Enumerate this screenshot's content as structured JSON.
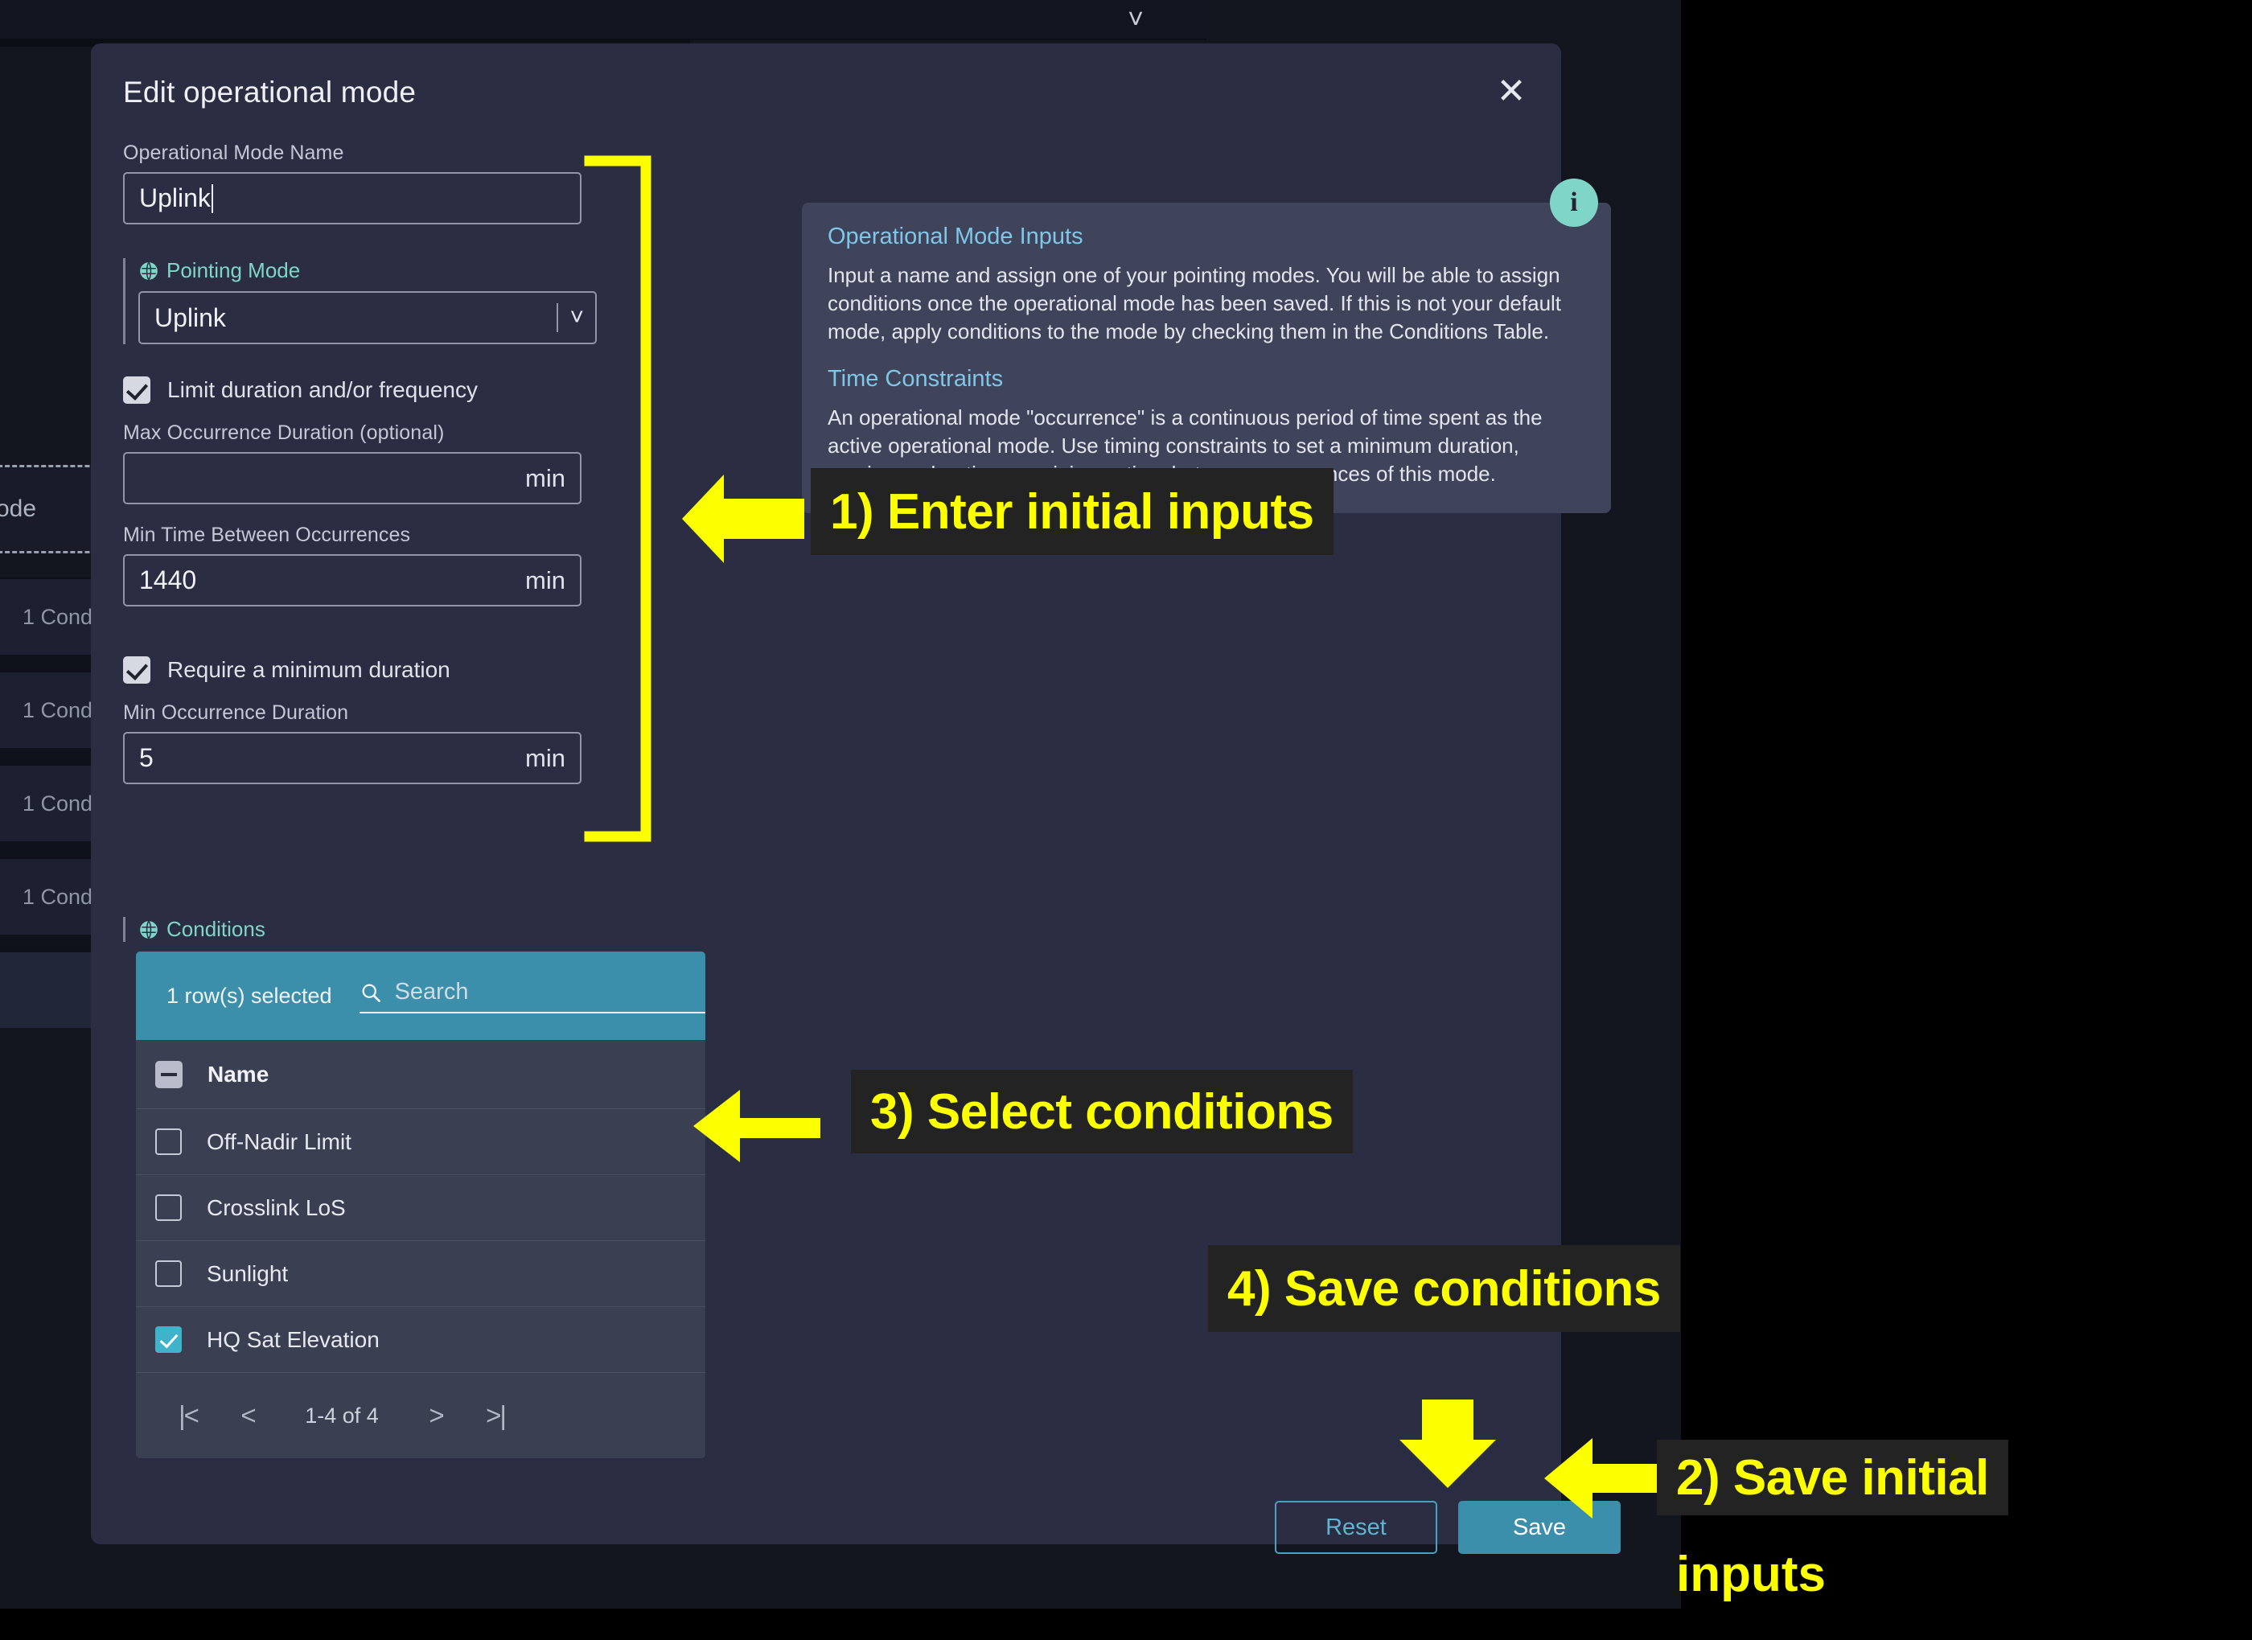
{
  "background": {
    "chevron_icon": "chevron-down-icon",
    "mode_label": "Mode",
    "rows": [
      {
        "label": "1 Cond"
      },
      {
        "label": "1 Cond"
      },
      {
        "label": "1 Cond"
      },
      {
        "label": "1 Cond"
      }
    ]
  },
  "modal": {
    "title": "Edit operational mode",
    "close_icon": "✕",
    "form": {
      "name_label": "Operational Mode Name",
      "name_value": "Uplink",
      "pointing_mode_label": "Pointing Mode",
      "pointing_mode_value": "Uplink",
      "limit_checkbox_label": "Limit duration and/or frequency",
      "max_occurrence_label": "Max Occurrence Duration (optional)",
      "max_occurrence_value": "",
      "max_occurrence_unit": "min",
      "min_time_between_label": "Min Time Between Occurrences",
      "min_time_between_value": "1440",
      "min_time_between_unit": "min",
      "require_min_checkbox_label": "Require a minimum duration",
      "min_occurrence_label": "Min Occurrence Duration",
      "min_occurrence_value": "5",
      "min_occurrence_unit": "min"
    },
    "conditions": {
      "section_label": "Conditions",
      "rows_selected": "1 row(s) selected",
      "search_placeholder": "Search",
      "search_value": "",
      "clear_icon": "✕",
      "column_header": "Name",
      "items": [
        {
          "name": "Off-Nadir Limit",
          "checked": false
        },
        {
          "name": "Crosslink LoS",
          "checked": false
        },
        {
          "name": "Sunlight",
          "checked": false
        },
        {
          "name": "HQ Sat Elevation",
          "checked": true
        }
      ],
      "pager": {
        "first": "|<",
        "prev": "<",
        "range": "1-4 of 4",
        "next": ">",
        "last": ">|"
      }
    },
    "info": {
      "badge": "i",
      "heading_1": "Operational Mode Inputs",
      "body_1": "Input a name and assign one of your pointing modes. You will be able to assign conditions once the operational mode has been saved. If this is not your default mode, apply conditions to the mode by checking them in the Conditions Table.",
      "heading_2": "Time Constraints",
      "body_2": "An operational mode \"occurrence\" is a continuous period of time spent as the active operational mode. Use timing constraints to set a minimum duration, maximum duration, or minimum time between occurrences of this mode."
    },
    "footer": {
      "reset_label": "Reset",
      "save_label": "Save"
    }
  },
  "annotations": {
    "step1": "1) Enter initial inputs",
    "step2_line1": "2) Save initial",
    "step2_line2": "inputs",
    "step3": "3) Select conditions",
    "step4": "4) Save conditions"
  },
  "colors": {
    "accent_teal": "#3b8fab",
    "mint": "#7fd6c8",
    "annotation_yellow": "#fbff00",
    "modal_bg": "#2b2e42",
    "info_bg": "#40445a"
  }
}
